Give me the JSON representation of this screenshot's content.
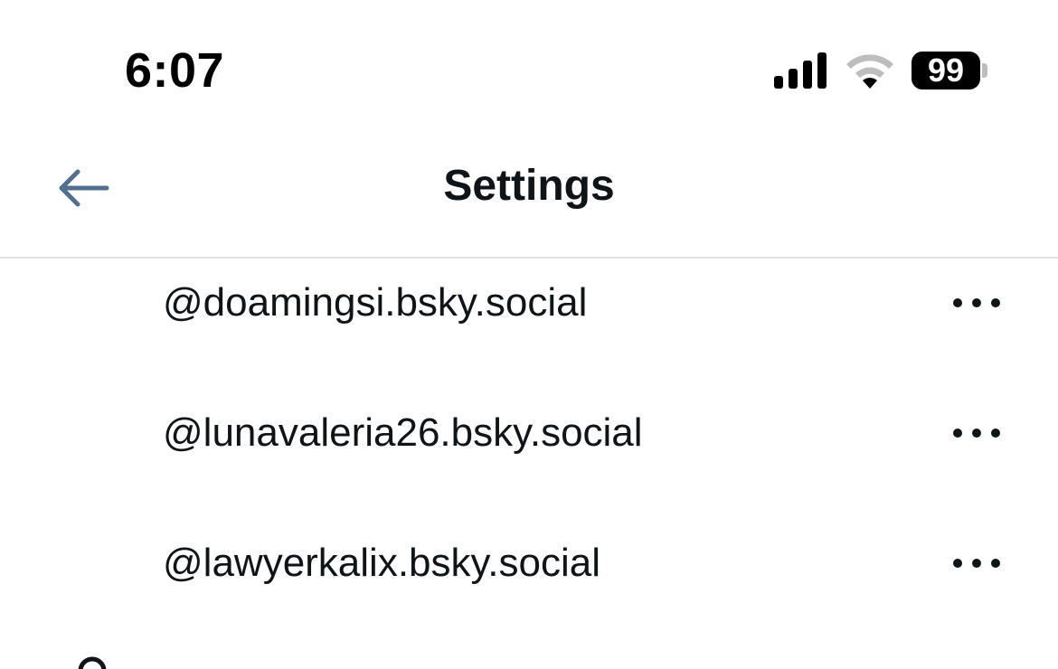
{
  "status_bar": {
    "time": "6:07",
    "battery": "99",
    "icons": [
      "cellular-signal-icon",
      "wifi-icon",
      "battery-icon"
    ]
  },
  "header": {
    "title": "Settings",
    "back_icon": "arrow-left-icon",
    "accent_color": "#51708f"
  },
  "accounts": [
    {
      "handle": "@doamingsi.bsky.social",
      "menu_icon": "more-horizontal-icon"
    },
    {
      "handle": "@lunavaleria26.bsky.social",
      "menu_icon": "more-horizontal-icon"
    },
    {
      "handle": "@lawyerkalix.bsky.social",
      "menu_icon": "more-horizontal-icon"
    }
  ],
  "next_item": {
    "icon": "user-plus-icon"
  }
}
